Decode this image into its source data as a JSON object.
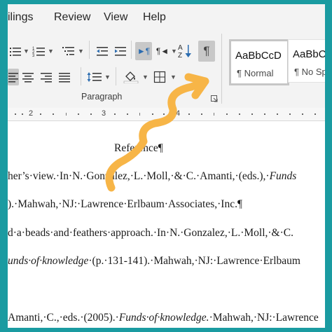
{
  "menubar": {
    "items": [
      "ilings",
      "Review",
      "View",
      "Help"
    ]
  },
  "ribbon": {
    "group_label": "Paragraph",
    "sort_label": "A\nZ",
    "styles": [
      {
        "sample": "AaBbCcD",
        "name": "¶ Normal"
      },
      {
        "sample": "AaBbCc",
        "name": "¶ No Spa"
      }
    ]
  },
  "ruler": {
    "numbers": [
      "2",
      "3",
      "4"
    ]
  },
  "document": {
    "lines": [
      {
        "parts": [
          {
            "t": "Reference¶",
            "i": false
          }
        ]
      },
      {
        "parts": [
          {
            "t": "her’s·view.·In·N.·Gonzalez,·L.·Moll,·&·C.·Amanti,·(eds.),·",
            "i": false
          },
          {
            "t": "Funds",
            "i": true
          }
        ]
      },
      {
        "parts": [
          {
            "t": ").·Mahwah,·NJ:·Lawrence·Erlbaum·Associates,·Inc.¶",
            "i": false
          }
        ]
      },
      {
        "parts": [
          {
            "t": "d·a·beads·and·feathers·approach.·In·N.·Gonzalez,·L.·Moll,·&·C.",
            "i": false
          }
        ]
      },
      {
        "parts": [
          {
            "t": "unds·of·knowledge",
            "i": true
          },
          {
            "t": "·(p.·131-141).·Mahwah,·NJ:·Lawrence·Erlbaum",
            "i": false
          }
        ]
      },
      {
        "parts": [
          {
            "t": "Amanti,·C.,·eds.·(2005).·",
            "i": false
          },
          {
            "t": "Funds·of·knowledge.",
            "i": true
          },
          {
            "t": "·Mahwah,·NJ:·Lawrence",
            "i": false
          }
        ]
      }
    ]
  },
  "colors": {
    "frame": "#1a9ba1",
    "annotation_arrow": "#f7b547",
    "active_button": "#c8c8c8"
  }
}
